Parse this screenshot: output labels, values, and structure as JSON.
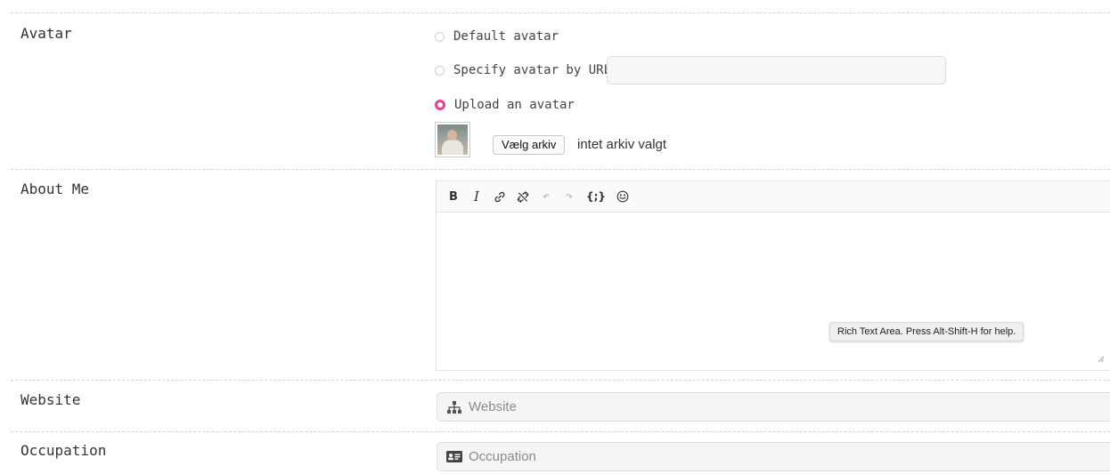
{
  "avatar": {
    "label": "Avatar",
    "options": [
      {
        "label": "Default avatar",
        "checked": false
      },
      {
        "label": "Specify avatar by URL:",
        "checked": false
      },
      {
        "label": "Upload an avatar",
        "checked": true
      }
    ],
    "url_value": "",
    "file_button": "Vælg arkiv",
    "file_status": "intet arkiv valgt"
  },
  "about": {
    "label": "About Me",
    "toolbar": [
      {
        "name": "bold",
        "glyph": "B",
        "enabled": true
      },
      {
        "name": "italic",
        "glyph": "I",
        "enabled": true
      },
      {
        "name": "link",
        "glyph": "link-icon",
        "enabled": true
      },
      {
        "name": "unlink",
        "glyph": "unlink-icon",
        "enabled": true
      },
      {
        "name": "undo",
        "glyph": "↶",
        "enabled": false
      },
      {
        "name": "redo",
        "glyph": "↷",
        "enabled": false
      },
      {
        "name": "code",
        "glyph": "{;}",
        "enabled": true
      },
      {
        "name": "emoji",
        "glyph": "smiley-icon",
        "enabled": true
      }
    ],
    "tooltip": "Rich Text Area. Press Alt-Shift-H for help."
  },
  "website": {
    "label": "Website",
    "placeholder": "Website",
    "icon": "sitemap-icon"
  },
  "occupation": {
    "label": "Occupation",
    "placeholder": "Occupation",
    "icon": "id-card-icon"
  },
  "colors": {
    "accent": "#e8418f",
    "divider": "#d2d2d2",
    "input_bg": "#f5f5f5"
  }
}
